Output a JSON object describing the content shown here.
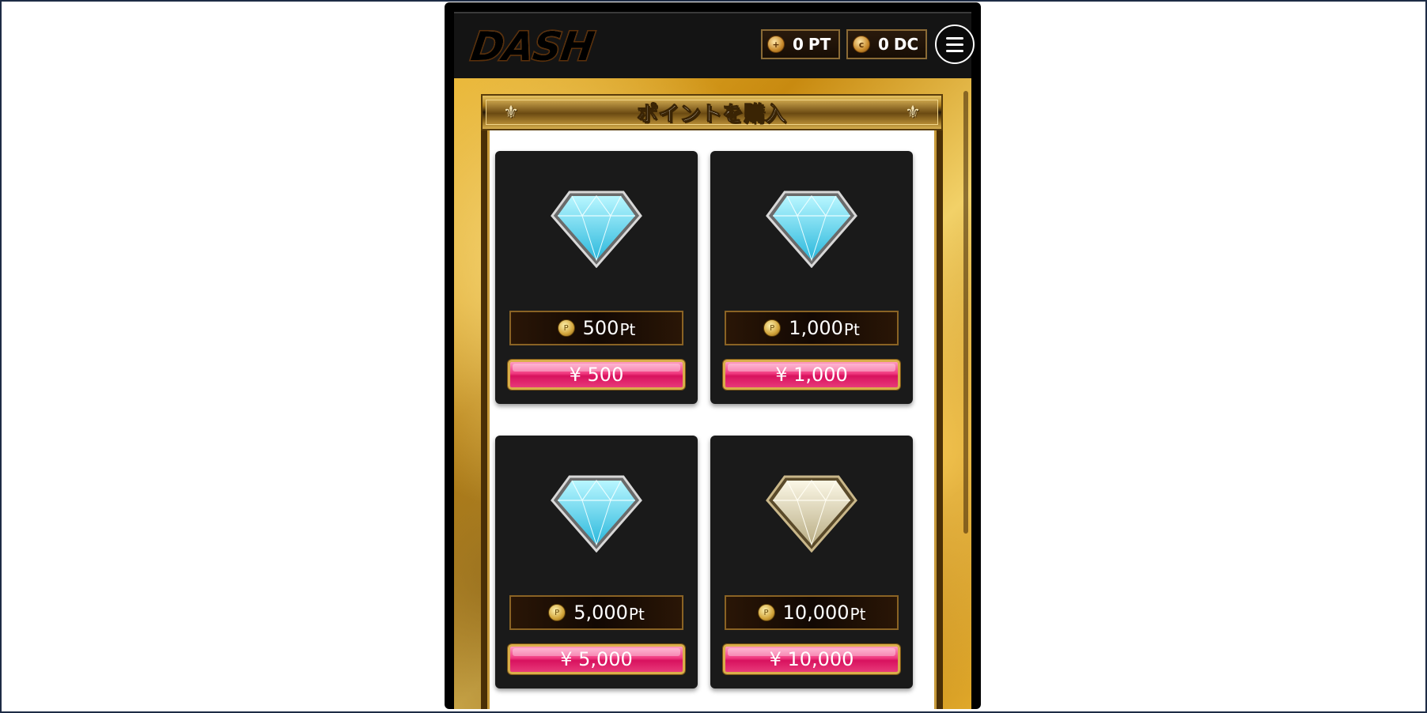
{
  "header": {
    "logo_text": "DASH",
    "balance_pt": {
      "amount": "0",
      "unit": "PT",
      "coin_icon": "point-coin-icon"
    },
    "balance_dc": {
      "amount": "0",
      "unit": "DC",
      "coin_icon": "dash-coin-icon"
    },
    "menu_icon": "hamburger-icon"
  },
  "section": {
    "title": "ポイントを購入",
    "ornament": "⚜"
  },
  "products": [
    {
      "points": "500",
      "unit": "Pt",
      "price": "¥ 500",
      "gem": "blue-diamond-icon"
    },
    {
      "points": "1,000",
      "unit": "Pt",
      "price": "¥ 1,000",
      "gem": "blue-diamond-icon"
    },
    {
      "points": "5,000",
      "unit": "Pt",
      "price": "¥ 5,000",
      "gem": "blue-diamond-icon"
    },
    {
      "points": "10,000",
      "unit": "Pt",
      "price": "¥ 10,000",
      "gem": "white-diamond-icon"
    }
  ],
  "colors": {
    "accent_pink": "#f03a80",
    "gold": "#d9ae4a",
    "gem_blue": "#4fd6f0",
    "gem_white": "#e8e2c8"
  }
}
